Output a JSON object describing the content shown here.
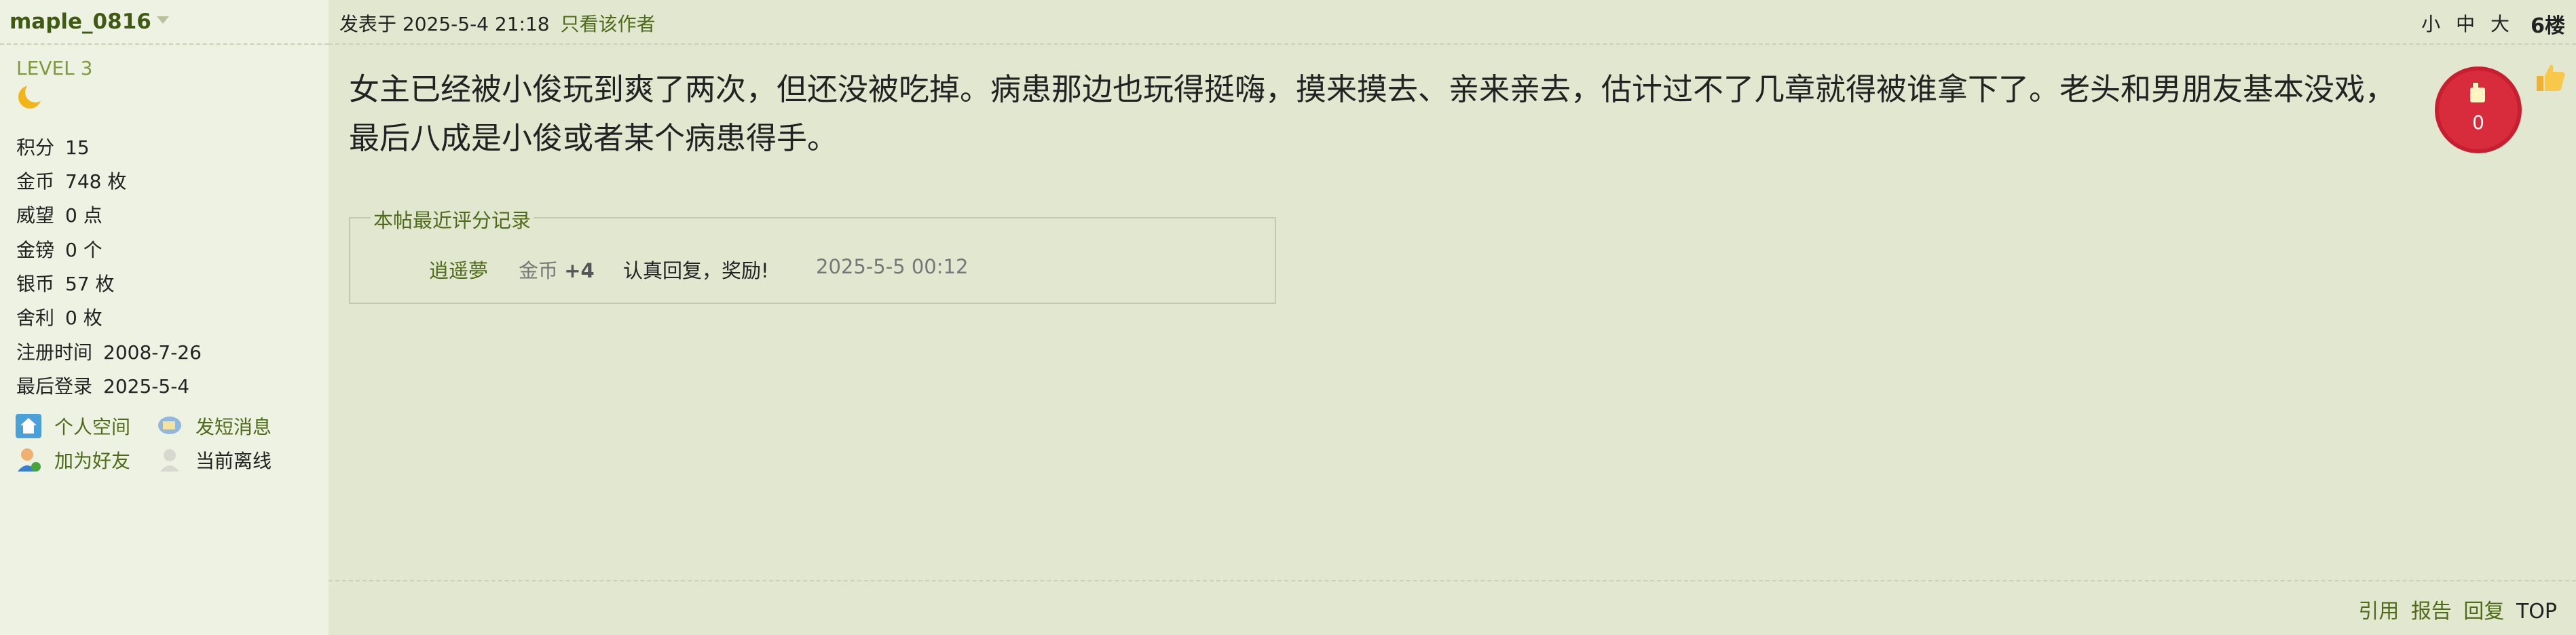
{
  "user": {
    "name": "maple_0816",
    "level": "LEVEL 3",
    "stats": [
      {
        "label": "积分",
        "value": "15"
      },
      {
        "label": "金币",
        "value": "748 枚"
      },
      {
        "label": "威望",
        "value": "0 点"
      },
      {
        "label": "金镑",
        "value": "0 个"
      },
      {
        "label": "银币",
        "value": "57 枚"
      },
      {
        "label": "舍利",
        "value": "0 枚"
      },
      {
        "label": "注册时间",
        "value": "2008-7-26"
      },
      {
        "label": "最后登录",
        "value": "2025-5-4"
      }
    ],
    "links": {
      "home": "个人空间",
      "message": "发短消息",
      "add_friend": "加为好友",
      "status": "当前离线"
    }
  },
  "post": {
    "time": "发表于 2025-5-4 21:18",
    "only_author": "只看该作者",
    "font_sizes": [
      "小",
      "中",
      "大"
    ],
    "floor": "6楼",
    "content": "女主已经被小俊玩到爽了两次，但还没被吃掉。病患那边也玩得挺嗨，摸来摸去、亲来亲去，估计过不了几章就得被谁拿下了。老头和男朋友基本没戏，最后八成是小俊或者某个病患得手。",
    "like_count": "0"
  },
  "rating": {
    "legend": "本帖最近评分记录",
    "user": "逍遥夢",
    "type": "金币",
    "amount": "+4",
    "reason": "认真回复，奖励!",
    "time": "2025-5-5 00:12"
  },
  "footer": {
    "quote": "引用",
    "report": "报告",
    "reply": "回复",
    "top": "TOP"
  },
  "colors": {
    "background": "#e2e8d0",
    "sidebar": "#eef2e3",
    "link": "#4f6b1a",
    "badge_red": "#d22a3a"
  }
}
